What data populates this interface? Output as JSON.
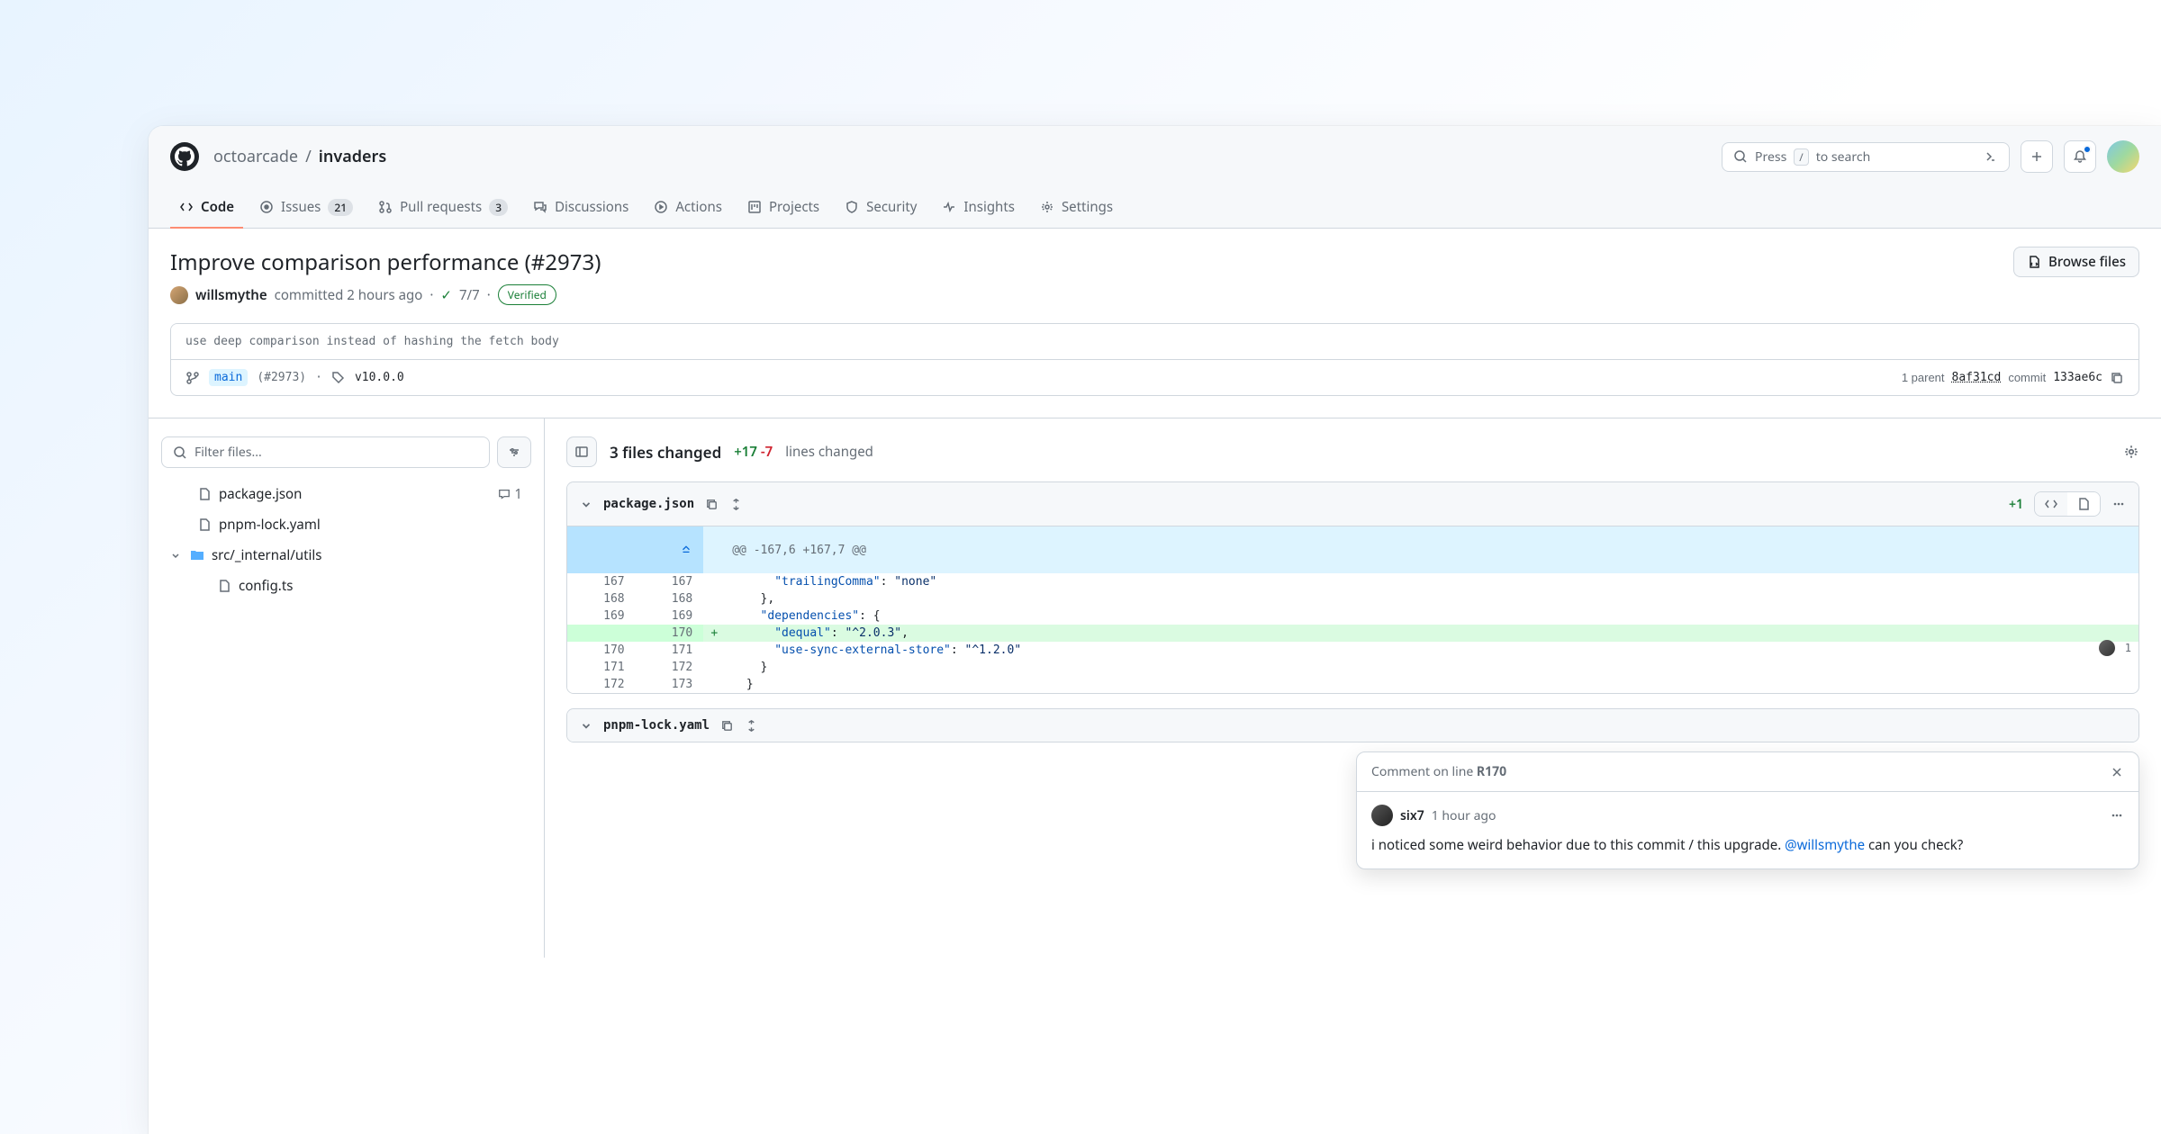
{
  "breadcrumb": {
    "org": "octoarcade",
    "repo": "invaders"
  },
  "search": {
    "prefix": "Press",
    "key": "/",
    "suffix": "to search"
  },
  "nav": {
    "code": "Code",
    "issues": "Issues",
    "issues_count": "21",
    "pulls": "Pull requests",
    "pulls_count": "3",
    "discussions": "Discussions",
    "actions": "Actions",
    "projects": "Projects",
    "security": "Security",
    "insights": "Insights",
    "settings": "Settings"
  },
  "commit": {
    "title": "Improve comparison performance (#2973)",
    "author": "willsmythe",
    "committed": "committed 2 hours ago",
    "checks": "7/7",
    "verified": "Verified",
    "message": "use deep comparison instead of hashing the fetch body",
    "branch": "main",
    "pr_ref": "(#2973)",
    "tag": "v10.0.0",
    "parent_label": "1 parent",
    "parent_hash": "8af31cd",
    "commit_label": "commit",
    "commit_hash": "133ae6c",
    "browse": "Browse files"
  },
  "sidebar": {
    "filter_placeholder": "Filter files...",
    "items": [
      {
        "label": "package.json",
        "comments": "1"
      },
      {
        "label": "pnpm-lock.yaml"
      }
    ],
    "folder": "src/_internal/utils",
    "folder_child": "config.ts"
  },
  "summary": {
    "files_changed": "3 files changed",
    "added": "+17",
    "removed": "-7",
    "lines": "lines changed"
  },
  "diff1": {
    "filename": "package.json",
    "added": "+1",
    "hunk": "@@ -167,6 +167,7 @@",
    "rows": [
      {
        "l": "167",
        "r": "167",
        "code": "      \"trailingComma\": \"none\""
      },
      {
        "l": "168",
        "r": "168",
        "code": "    },"
      },
      {
        "l": "169",
        "r": "169",
        "code": "    \"dependencies\": {"
      },
      {
        "l": "",
        "r": "170",
        "code": "      \"dequal\": \"^2.0.3\",",
        "add": true,
        "comments": "1"
      },
      {
        "l": "170",
        "r": "171",
        "code": "      \"use-sync-external-store\": \"^1.2.0\""
      },
      {
        "l": "171",
        "r": "172",
        "code": "    }"
      },
      {
        "l": "172",
        "r": "173",
        "code": "  }"
      }
    ]
  },
  "diff2": {
    "filename": "pnpm-lock.yaml"
  },
  "comment": {
    "header_prefix": "Comment on line ",
    "header_line": "R170",
    "author": "six7",
    "time": "1 hour ago",
    "text_before": "i noticed some weird behavior due to this commit / this upgrade. ",
    "mention": "@willsmythe",
    "text_after": " can you check?"
  }
}
